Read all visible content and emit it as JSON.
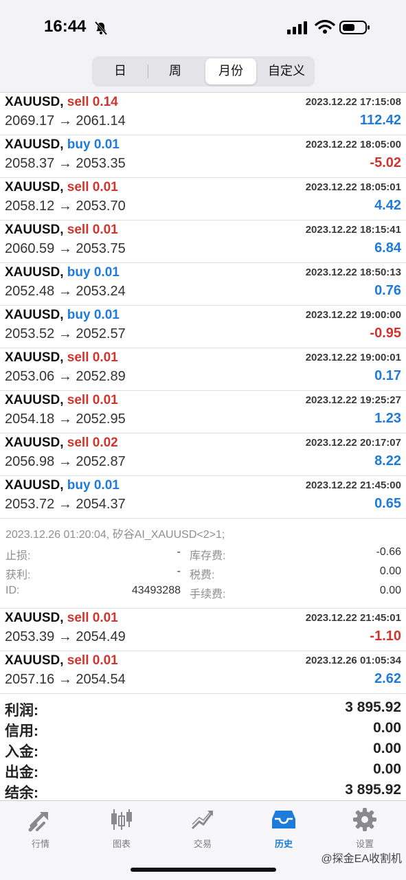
{
  "status": {
    "time": "16:44"
  },
  "segments": [
    {
      "label": "日"
    },
    {
      "label": "周"
    },
    {
      "label": "月份"
    },
    {
      "label": "自定义"
    }
  ],
  "active_segment": "月份",
  "trades": [
    {
      "symbol": "XAUUSD,",
      "side": "sell",
      "side_text": "sell 0.14",
      "time": "2023.12.22 17:15:08",
      "prices": "2069.17 → 2061.14",
      "profit": "112.42",
      "sign": "pos"
    },
    {
      "symbol": "XAUUSD,",
      "side": "buy",
      "side_text": "buy 0.01",
      "time": "2023.12.22 18:05:00",
      "prices": "2058.37 → 2053.35",
      "profit": "-5.02",
      "sign": "neg"
    },
    {
      "symbol": "XAUUSD,",
      "side": "sell",
      "side_text": "sell 0.01",
      "time": "2023.12.22 18:05:01",
      "prices": "2058.12 → 2053.70",
      "profit": "4.42",
      "sign": "pos"
    },
    {
      "symbol": "XAUUSD,",
      "side": "sell",
      "side_text": "sell 0.01",
      "time": "2023.12.22 18:15:41",
      "prices": "2060.59 → 2053.75",
      "profit": "6.84",
      "sign": "pos"
    },
    {
      "symbol": "XAUUSD,",
      "side": "buy",
      "side_text": "buy 0.01",
      "time": "2023.12.22 18:50:13",
      "prices": "2052.48 → 2053.24",
      "profit": "0.76",
      "sign": "pos"
    },
    {
      "symbol": "XAUUSD,",
      "side": "buy",
      "side_text": "buy 0.01",
      "time": "2023.12.22 19:00:00",
      "prices": "2053.52 → 2052.57",
      "profit": "-0.95",
      "sign": "neg"
    },
    {
      "symbol": "XAUUSD,",
      "side": "sell",
      "side_text": "sell 0.01",
      "time": "2023.12.22 19:00:01",
      "prices": "2053.06 → 2052.89",
      "profit": "0.17",
      "sign": "pos"
    },
    {
      "symbol": "XAUUSD,",
      "side": "sell",
      "side_text": "sell 0.01",
      "time": "2023.12.22 19:25:27",
      "prices": "2054.18 → 2052.95",
      "profit": "1.23",
      "sign": "pos"
    },
    {
      "symbol": "XAUUSD,",
      "side": "sell",
      "side_text": "sell 0.02",
      "time": "2023.12.22 20:17:07",
      "prices": "2056.98 → 2052.87",
      "profit": "8.22",
      "sign": "pos"
    },
    {
      "symbol": "XAUUSD,",
      "side": "buy",
      "side_text": "buy 0.01",
      "time": "2023.12.22 21:45:00",
      "prices": "2053.72 → 2054.37",
      "profit": "0.65",
      "sign": "pos"
    }
  ],
  "detail": {
    "header": "2023.12.26 01:20:04, 矽谷AI_XAUUSD<2>1;",
    "stop_loss_label": "止损:",
    "stop_loss_value": "-",
    "take_profit_label": "获利:",
    "take_profit_value": "-",
    "id_label": "ID:",
    "id_value": "43493288",
    "swap_label": "库存费:",
    "swap_value": "-0.66",
    "tax_label": "税费:",
    "tax_value": "0.00",
    "fee_label": "手续费:",
    "fee_value": "0.00"
  },
  "trades_after": [
    {
      "symbol": "XAUUSD,",
      "side": "sell",
      "side_text": "sell 0.01",
      "time": "2023.12.22 21:45:01",
      "prices": "2053.39 → 2054.49",
      "profit": "-1.10",
      "sign": "neg"
    },
    {
      "symbol": "XAUUSD,",
      "side": "sell",
      "side_text": "sell 0.01",
      "time": "2023.12.26 01:05:34",
      "prices": "2057.16 → 2054.54",
      "profit": "2.62",
      "sign": "pos"
    }
  ],
  "summary": {
    "profit_label": "利润:",
    "profit_value": "3 895.92",
    "credit_label": "信用:",
    "credit_value": "0.00",
    "deposit_label": "入金:",
    "deposit_value": "0.00",
    "withdraw_label": "出金:",
    "withdraw_value": "0.00",
    "balance_label": "结余:",
    "balance_value": "3 895.92"
  },
  "tabs": [
    {
      "label": "行情",
      "icon": "quotes-icon"
    },
    {
      "label": "图表",
      "icon": "chart-icon"
    },
    {
      "label": "交易",
      "icon": "trade-icon"
    },
    {
      "label": "历史",
      "icon": "history-icon"
    },
    {
      "label": "设置",
      "icon": "settings-icon"
    }
  ],
  "active_tab": "历史",
  "watermark": "@探金EA收割机",
  "colors": {
    "sell": "#d0342c",
    "buy": "#1d7bd9",
    "active": "#1d7bd9"
  }
}
